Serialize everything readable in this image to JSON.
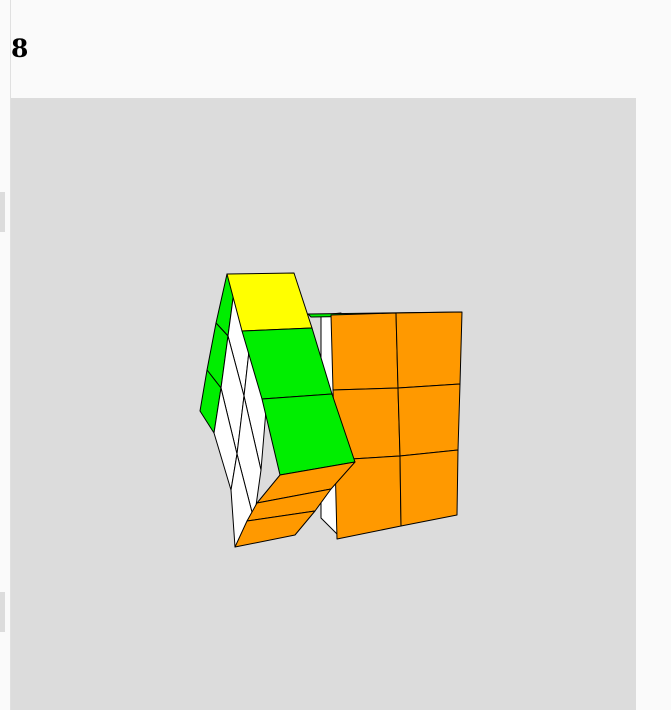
{
  "page": {
    "heading": "8"
  },
  "scene": {
    "background": "#dcdcdc",
    "colors": {
      "green": "#00ee00",
      "yellow": "#ffff00",
      "orange": "#ff9900",
      "white": "#ffffff",
      "edge": "#000000"
    }
  }
}
